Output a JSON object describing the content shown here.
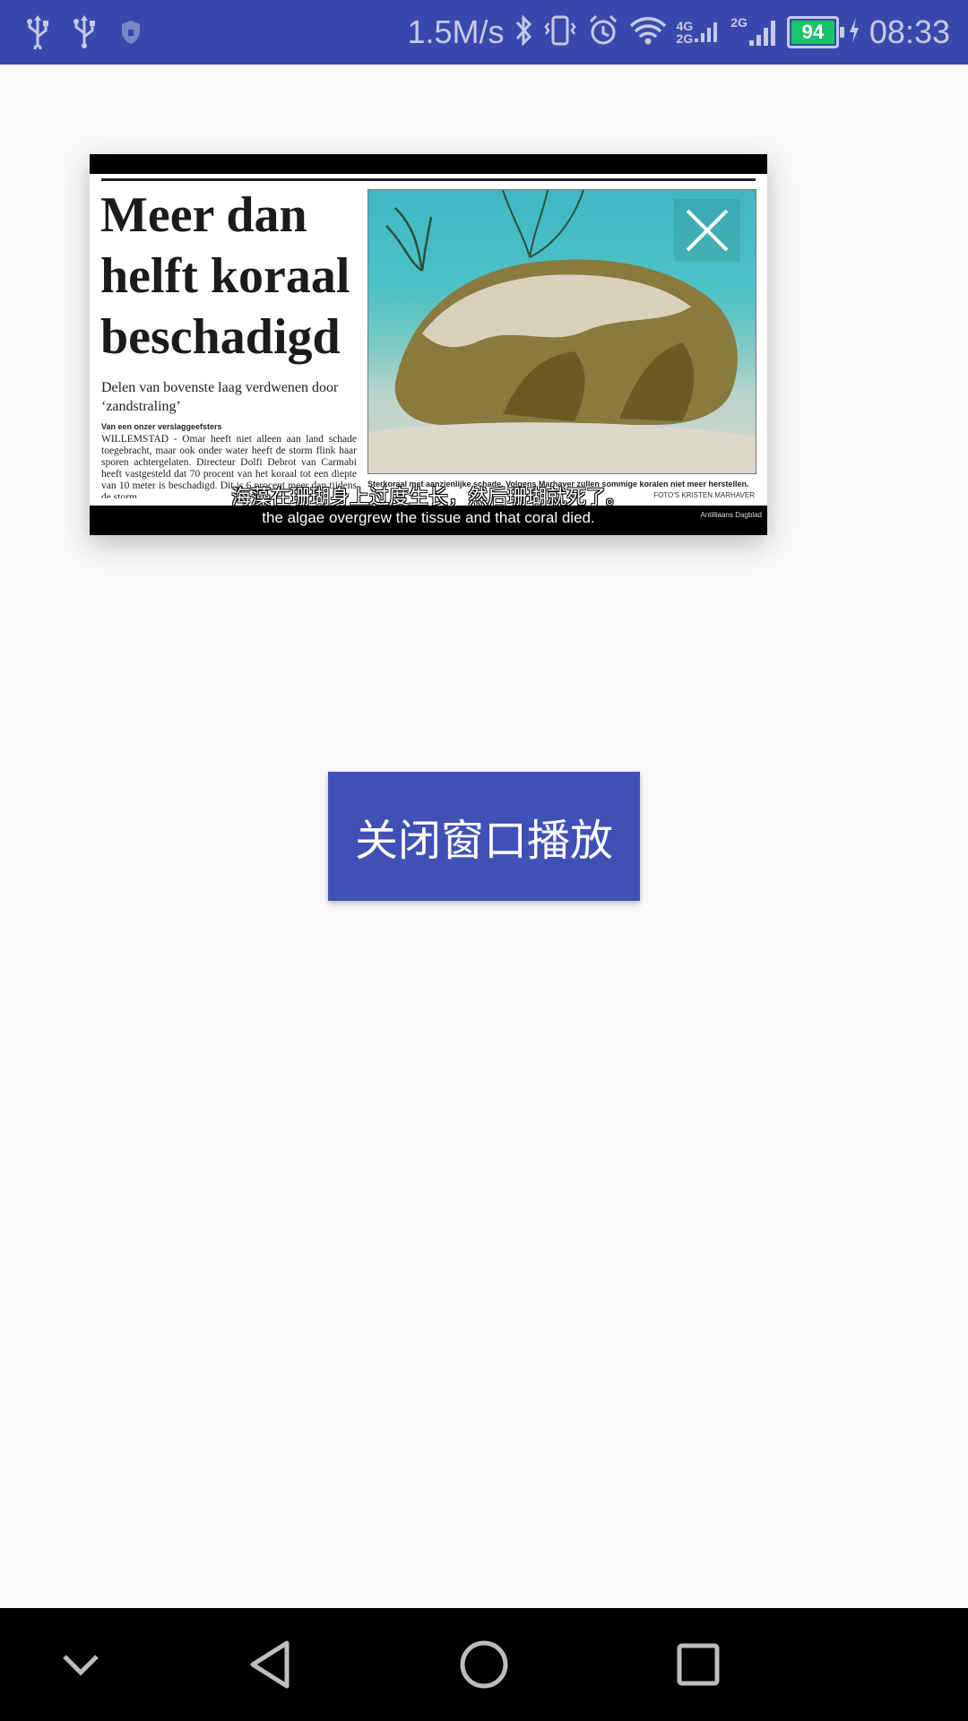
{
  "status_bar": {
    "speed": "1.5M/s",
    "battery_level": "94",
    "time": "08:33",
    "signal_4g_label": "4G",
    "signal_2g_label": "2G",
    "icons": [
      "usb-icon",
      "usb-icon",
      "shield-icon",
      "bluetooth-icon",
      "vibrate-icon",
      "alarm-icon",
      "wifi-icon",
      "signal-icon",
      "battery-icon",
      "charging-icon"
    ]
  },
  "video": {
    "headline": "Meer dan helft koraal beschadigd",
    "subhead": "Delen van bovenste laag verdwenen door ‘zandstraling’",
    "byline": "Van een onzer verslaggeefsters",
    "body": "WILLEMSTAD - Omar heeft niet alleen aan land schade toegebracht, maar ook onder water heeft de storm flink haar sporen achtergelaten. Directeur Dolfi Debrot van Carmabi heeft vastgesteld dat 70 procent van het koraal tot een diepte van 10 meter is beschadigd. Dit is 6 procent meer dan tijdens de storm",
    "caption": "Sterkoraal met aanzienlijke schade. Volgens Marhaver zullen sommige koralen niet meer herstellen.",
    "photo_credit": "FOTO'S KRISTEN MARHAVER",
    "subtitle_cn": "海藻在珊瑚身上过度生长，然后珊瑚就死了。",
    "subtitle_en": "the algae overgrew the tissue and that coral died.",
    "source_label": "Antilliaans Dagblad"
  },
  "main": {
    "close_window_button": "关闭窗口播放"
  },
  "colors": {
    "status_bar": "#3949ab",
    "button": "#3f51b5",
    "background": "#fafafa",
    "nav_bar": "#000000",
    "battery_fill": "#18c46b"
  }
}
